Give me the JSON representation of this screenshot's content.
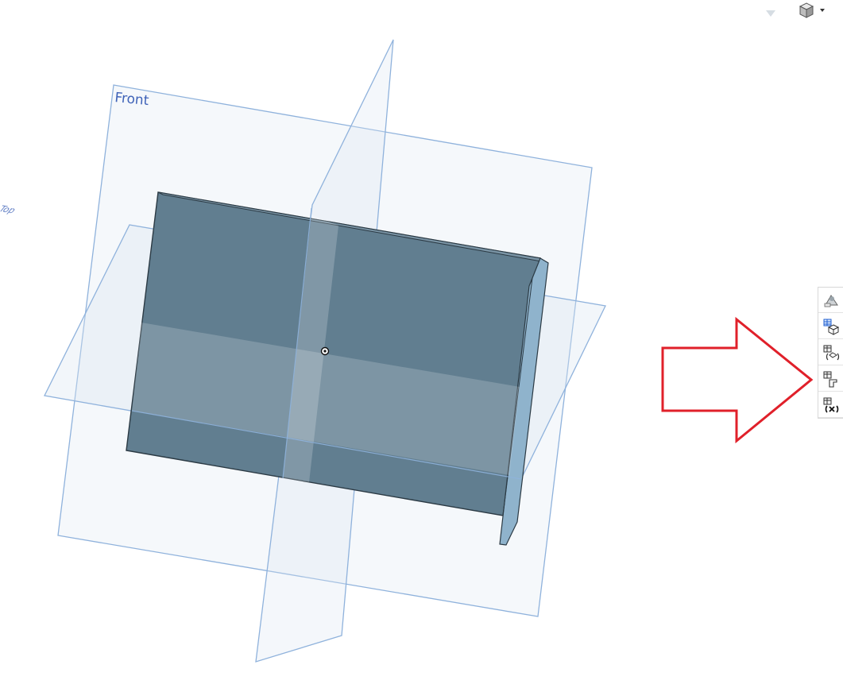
{
  "viewport": {
    "planes": {
      "front_label": "Front",
      "top_label": "Top"
    },
    "colors": {
      "plane_fill": "#dbe6f2",
      "plane_stroke": "#8fb2dc",
      "part_face": "#617e90",
      "part_edge": "#2b3a44",
      "flange_face": "#8fb3cc",
      "annotation_arrow": "#e0202a"
    }
  },
  "view_controls": {
    "view_cube_icon": "view-cube-icon",
    "caret_icon": "caret-down-icon"
  },
  "right_panel": {
    "buttons": [
      {
        "icon": "appearance-icon"
      },
      {
        "icon": "parts-list-icon"
      },
      {
        "icon": "mass-properties-icon"
      },
      {
        "icon": "sheet-metal-table-icon"
      },
      {
        "icon": "variables-icon"
      }
    ]
  }
}
